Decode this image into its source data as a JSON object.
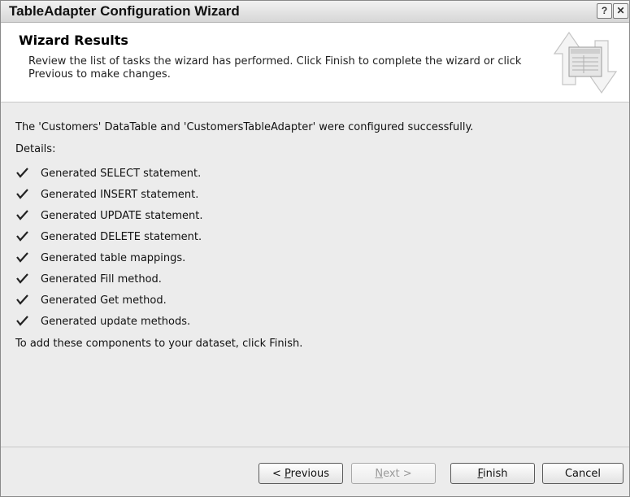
{
  "window": {
    "title": "TableAdapter Configuration Wizard",
    "help_glyph": "?",
    "close_glyph": "✕"
  },
  "header": {
    "title": "Wizard Results",
    "description": "Review the list of tasks the wizard has performed. Click Finish to complete the wizard or click Previous to make changes."
  },
  "content": {
    "summary": "The 'Customers' DataTable and 'CustomersTableAdapter' were configured successfully.",
    "details_label": "Details:",
    "tasks": [
      "Generated SELECT statement.",
      "Generated INSERT statement.",
      "Generated UPDATE statement.",
      "Generated DELETE statement.",
      "Generated table mappings.",
      "Generated Fill method.",
      "Generated Get method.",
      "Generated update methods."
    ],
    "footer_note": "To add these components to your dataset, click Finish."
  },
  "buttons": {
    "previous": {
      "prefix": "< ",
      "accel": "P",
      "rest": "revious",
      "enabled": true
    },
    "next": {
      "accel": "N",
      "rest": "ext >",
      "enabled": false
    },
    "finish": {
      "accel": "F",
      "rest": "inish",
      "enabled": true
    },
    "cancel": {
      "label": "Cancel",
      "enabled": true
    }
  },
  "colors": {
    "window_bg": "#ececec",
    "header_bg": "#ffffff",
    "check_color": "#222222"
  }
}
